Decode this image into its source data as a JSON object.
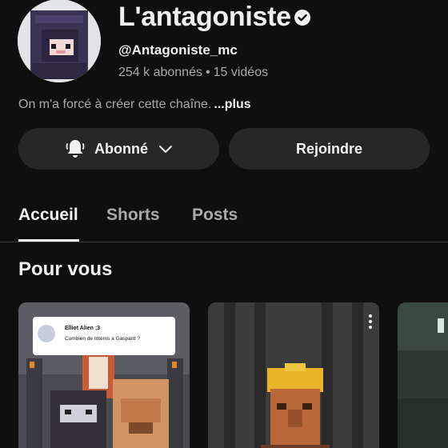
{
  "channel": {
    "name": "L'antagoniste",
    "handle": "@Antagoniste_mc",
    "subscribers": "254 k abonnés",
    "separator": "•",
    "videos": "15 vidéos",
    "description": "On m'a forcé à créer cette chaîne.",
    "more_label": "...plus",
    "verified_icon": "verified-check-icon"
  },
  "actions": {
    "subscribed_label": "Abonné",
    "join_label": "Rejoindre",
    "bell_icon": "bell-icon",
    "chevron_icon": "chevron-down-icon"
  },
  "tabs": [
    {
      "label": "Accueil",
      "active": true
    },
    {
      "label": "Shorts",
      "active": false
    },
    {
      "label": "Posts",
      "active": false
    }
  ],
  "section": {
    "title": "Pour vous"
  },
  "cards": [
    {
      "comment_author": "Elliot Alien ;3",
      "comment_text": "Combien de totems a Gaspard ?"
    },
    {
      "menu_icon": "more-vertical-icon"
    },
    {}
  ],
  "colors": {
    "background": "#0f0f0f",
    "button": "#272727",
    "text_primary": "#f1f1f1",
    "text_secondary": "#aaaaaa"
  }
}
